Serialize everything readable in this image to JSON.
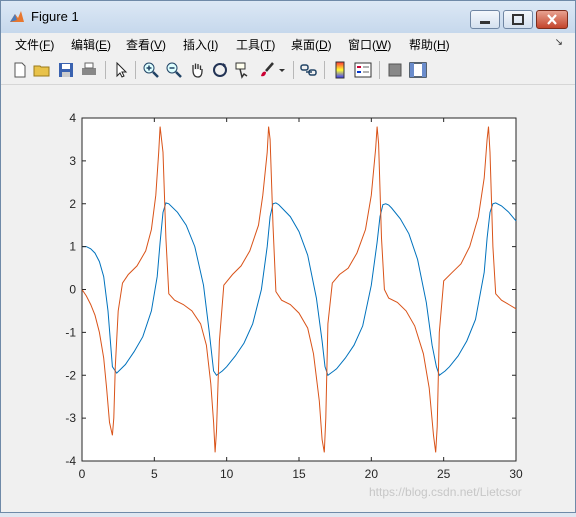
{
  "window": {
    "title": "Figure 1"
  },
  "menu": {
    "items": [
      {
        "label": "文件(",
        "key": "F",
        "tail": ")"
      },
      {
        "label": "编辑(",
        "key": "E",
        "tail": ")"
      },
      {
        "label": "查看(",
        "key": "V",
        "tail": ")"
      },
      {
        "label": "插入(",
        "key": "I",
        "tail": ")"
      },
      {
        "label": "工具(",
        "key": "T",
        "tail": ")"
      },
      {
        "label": "桌面(",
        "key": "D",
        "tail": ")"
      },
      {
        "label": "窗口(",
        "key": "W",
        "tail": ")"
      },
      {
        "label": "帮助(",
        "key": "H",
        "tail": ")"
      }
    ]
  },
  "toolbar": {
    "icons": [
      "new-figure-icon",
      "open-icon",
      "save-icon",
      "print-icon",
      "pointer-icon",
      "zoom-in-icon",
      "zoom-out-icon",
      "pan-icon",
      "rotate-icon",
      "data-cursor-icon",
      "brush-icon",
      "link-plot-icon",
      "colorbar-icon",
      "legend-icon",
      "hide-plot-tools-icon",
      "show-plot-tools-icon"
    ]
  },
  "colors": {
    "series1": "#0072bd",
    "series2": "#d95319",
    "accent": "#c6d8ec"
  },
  "chart_data": {
    "type": "line",
    "title": "",
    "xlabel": "",
    "ylabel": "",
    "xlim": [
      0,
      30
    ],
    "ylim": [
      -4,
      4
    ],
    "xticks": [
      0,
      5,
      10,
      15,
      20,
      25,
      30
    ],
    "yticks": [
      -4,
      -3,
      -2,
      -1,
      0,
      1,
      2,
      3,
      4
    ],
    "grid": false,
    "series": [
      {
        "color": "#0072bd",
        "x": [
          0,
          0.3,
          0.6,
          0.9,
          1.2,
          1.5,
          1.8,
          2.1,
          2.4,
          3.0,
          3.6,
          4.2,
          4.8,
          5.2,
          5.4,
          5.6,
          5.8,
          6.0,
          6.6,
          7.2,
          7.8,
          8.4,
          8.8,
          9.1,
          9.3,
          9.5,
          9.7,
          10.0,
          10.6,
          11.2,
          11.8,
          12.4,
          12.8,
          13.0,
          13.2,
          13.4,
          13.6,
          14.4,
          15.0,
          15.6,
          16.2,
          16.6,
          16.8,
          17.0,
          17.2,
          17.4,
          17.6,
          18.2,
          18.8,
          19.4,
          20.0,
          20.4,
          20.6,
          20.8,
          21.0,
          21.2,
          21.4,
          22.0,
          22.6,
          23.2,
          23.8,
          24.2,
          24.5,
          24.7,
          24.9,
          25.1,
          25.4,
          26.0,
          26.6,
          27.2,
          27.8,
          28.0,
          28.2,
          28.4,
          28.6,
          29.0,
          29.5,
          30.0
        ],
        "y": [
          1.0,
          1.0,
          0.95,
          0.85,
          0.65,
          0.3,
          -0.5,
          -1.8,
          -1.95,
          -1.75,
          -1.45,
          -1.1,
          -0.5,
          0.3,
          1.1,
          1.8,
          2.02,
          2.0,
          1.8,
          1.5,
          1.0,
          0.1,
          -1.0,
          -1.9,
          -2.0,
          -1.95,
          -1.9,
          -1.8,
          -1.55,
          -1.25,
          -0.8,
          0.0,
          1.0,
          1.7,
          2.0,
          2.02,
          1.98,
          1.7,
          1.35,
          0.8,
          -0.2,
          -1.2,
          -1.8,
          -2.0,
          -1.95,
          -1.9,
          -1.85,
          -1.6,
          -1.3,
          -0.85,
          0.1,
          1.1,
          1.7,
          1.98,
          2.0,
          1.97,
          1.9,
          1.65,
          1.3,
          0.7,
          -0.3,
          -1.3,
          -1.8,
          -2.0,
          -1.95,
          -1.9,
          -1.8,
          -1.55,
          -1.2,
          -0.7,
          0.4,
          1.2,
          1.8,
          2.0,
          2.02,
          1.95,
          1.8,
          1.6
        ]
      },
      {
        "color": "#d95319",
        "x": [
          0,
          0.3,
          0.6,
          0.9,
          1.2,
          1.5,
          1.7,
          1.9,
          2.1,
          2.2,
          2.3,
          2.5,
          2.8,
          3.2,
          3.8,
          4.4,
          4.8,
          5.1,
          5.3,
          5.4,
          5.6,
          5.8,
          6.0,
          6.4,
          7.0,
          7.6,
          8.2,
          8.6,
          8.9,
          9.1,
          9.2,
          9.3,
          9.5,
          9.8,
          10.4,
          11.0,
          11.6,
          12.2,
          12.5,
          12.8,
          12.9,
          13.0,
          13.2,
          13.4,
          13.8,
          14.4,
          15.0,
          15.6,
          16.0,
          16.4,
          16.6,
          16.75,
          16.85,
          17.0,
          17.3,
          17.8,
          18.4,
          19.0,
          19.6,
          20.0,
          20.3,
          20.4,
          20.5,
          20.7,
          20.9,
          21.2,
          21.8,
          22.4,
          23.0,
          23.6,
          24.0,
          24.3,
          24.45,
          24.55,
          24.7,
          25.0,
          25.6,
          26.2,
          26.8,
          27.4,
          27.8,
          28.0,
          28.1,
          28.2,
          28.4,
          28.6,
          29.0,
          29.5,
          30.0
        ],
        "y": [
          0,
          -0.15,
          -0.35,
          -0.6,
          -1.0,
          -1.6,
          -2.3,
          -3.1,
          -3.4,
          -3.0,
          -1.8,
          -0.5,
          0.15,
          0.35,
          0.55,
          0.9,
          1.4,
          2.2,
          3.2,
          3.8,
          3.2,
          1.2,
          -0.1,
          -0.25,
          -0.35,
          -0.5,
          -0.8,
          -1.3,
          -2.2,
          -3.1,
          -3.8,
          -3.3,
          -1.2,
          0.1,
          0.35,
          0.55,
          0.9,
          1.5,
          2.2,
          3.2,
          3.8,
          3.5,
          1.5,
          -0.05,
          -0.25,
          -0.35,
          -0.55,
          -0.9,
          -1.5,
          -2.6,
          -3.5,
          -3.8,
          -3.0,
          -0.8,
          0.15,
          0.35,
          0.5,
          0.85,
          1.4,
          2.2,
          3.3,
          3.8,
          3.4,
          1.2,
          0.0,
          -0.2,
          -0.3,
          -0.5,
          -0.85,
          -1.5,
          -2.3,
          -3.4,
          -3.8,
          -3.2,
          -1.0,
          0.2,
          0.4,
          0.6,
          1.0,
          1.7,
          2.6,
          3.5,
          3.8,
          3.2,
          1.0,
          -0.1,
          -0.25,
          -0.35,
          -0.45
        ]
      }
    ]
  },
  "watermark": "https://blog.csdn.net/Lietcsor"
}
